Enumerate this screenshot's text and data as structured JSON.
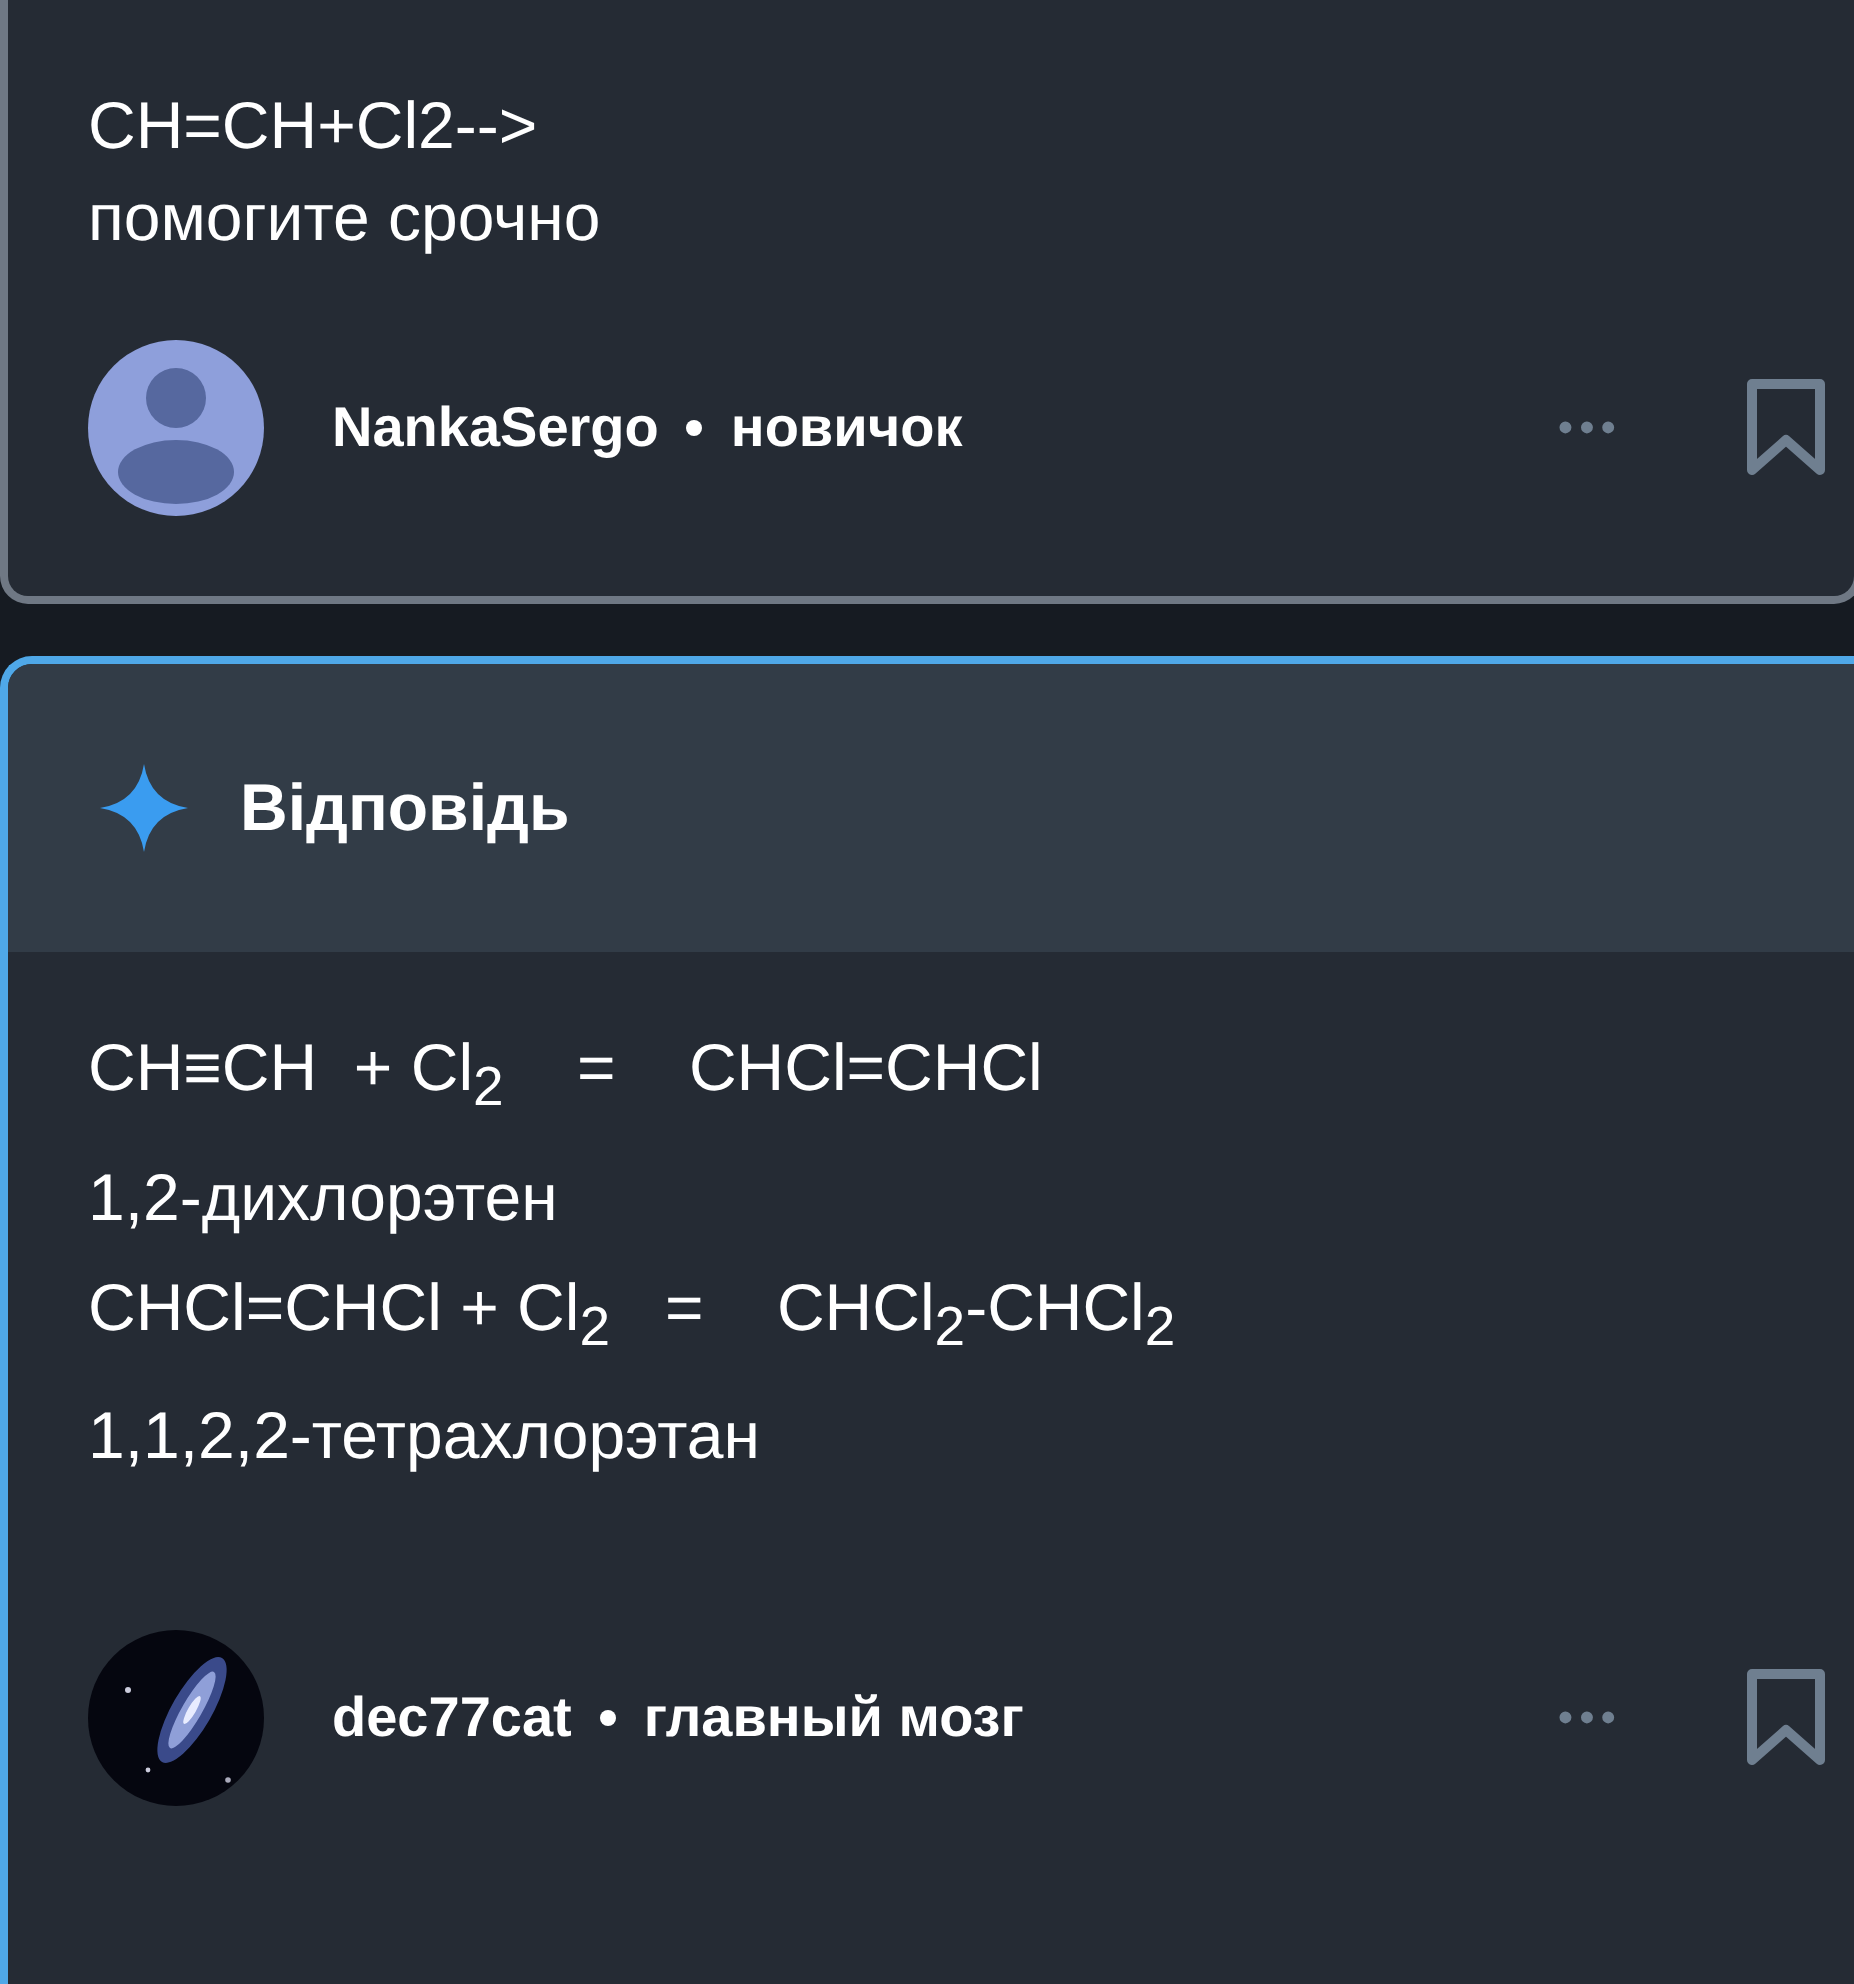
{
  "question": {
    "lines": [
      "CH=CH+Cl2-->",
      "помогите срочно"
    ],
    "author": {
      "name": "NankaSergo",
      "rank": "новичок",
      "kind": "icon"
    },
    "more": "•••"
  },
  "answer": {
    "heading": "Відповідь",
    "lines": [
      "CH≡CH  + Cl$_{2}$    =    CHCl=CHCl",
      "1,2-дихлорэтен",
      "CHCl=CHCl + Cl$_{2}$   =    CHCl$_{2}$-CHCl$_{2}$",
      "1,1,2,2-тетрахлорэтан"
    ],
    "author": {
      "name": "dec77cat",
      "rank": "главный мозг",
      "kind": "picture"
    },
    "more": "•••"
  }
}
